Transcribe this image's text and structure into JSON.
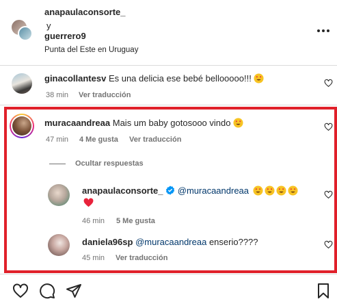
{
  "header": {
    "user1": "anapaulaconsorte_",
    "conjunction": "y",
    "user2": "guerrero9",
    "location": "Punta del Este en Uruguay",
    "more_icon": "more-horizontal-icon"
  },
  "comments": [
    {
      "username": "ginacollantesv",
      "text": "Es una delicia ese bebé bellooooo!!!",
      "time": "38 min",
      "translate": "Ver traducción"
    },
    {
      "username": "muracaandreaa",
      "text": "Mais um baby gotosooo vindo",
      "time": "47 min",
      "likes": "4 Me gusta",
      "translate": "Ver traducción",
      "hide_replies": "Ocultar respuestas"
    }
  ],
  "replies": [
    {
      "username": "anapaulaconsorte_",
      "mention": "@muracaandreaa",
      "time": "46 min",
      "likes": "5 Me gusta"
    },
    {
      "username": "daniela96sp",
      "mention": "@muracaandreaa",
      "text": "enserio????",
      "time": "45 min",
      "translate": "Ver traducción"
    }
  ],
  "actions": {
    "like_icon": "heart-icon",
    "comment_icon": "comment-icon",
    "share_icon": "send-icon",
    "save_icon": "bookmark-icon"
  },
  "colors": {
    "highlight": "#e0202a",
    "verified": "#0095f6",
    "meta": "#737373"
  }
}
